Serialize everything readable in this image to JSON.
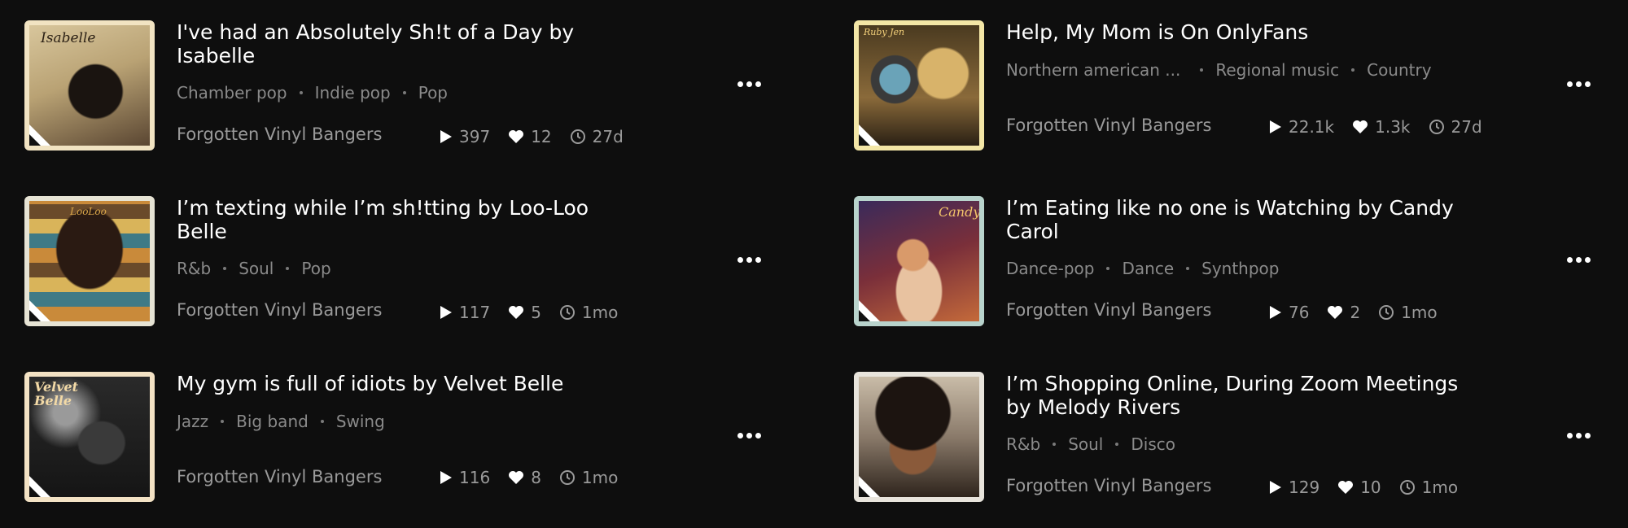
{
  "tracks": [
    {
      "title": "I've had an Absolutely Sh!t of a Day by Isabelle",
      "genres": [
        "Chamber pop",
        "Indie pop",
        "Pop"
      ],
      "playlist": "Forgotten Vinyl Bangers",
      "plays": "397",
      "likes": "12",
      "age": "27d",
      "cover_text": "Isabelle",
      "colors": {
        "bg1": "#c9b489",
        "bg2": "#3a2d22",
        "border": "#f1e3c2"
      }
    },
    {
      "title": "Help, My Mom is On OnlyFans",
      "genres": [
        "Northern american ...",
        "Regional music",
        "Country"
      ],
      "playlist": "Forgotten Vinyl Bangers",
      "plays": "22.1k",
      "likes": "1.3k",
      "age": "27d",
      "cover_text": "Ruby Jen",
      "colors": {
        "bg1": "#7a5a2a",
        "bg2": "#d6b072",
        "border": "#f3e6a6"
      }
    },
    {
      "title": "I’m texting while I’m sh!tting by Loo-Loo Belle",
      "genres": [
        "R&b",
        "Soul",
        "Pop"
      ],
      "playlist": "Forgotten Vinyl Bangers",
      "plays": "117",
      "likes": "5",
      "age": "1mo",
      "cover_text": "LooLoo",
      "colors": {
        "bg1": "#b97a3a",
        "bg2": "#3f6f7a",
        "border": "#e6e3d4"
      }
    },
    {
      "title": "I’m Eating like no one is Watching by Candy Carol",
      "genres": [
        "Dance-pop",
        "Dance",
        "Synthpop"
      ],
      "playlist": "Forgotten Vinyl Bangers",
      "plays": "76",
      "likes": "2",
      "age": "1mo",
      "cover_text": "Candy",
      "colors": {
        "bg1": "#6a2f3a",
        "bg2": "#c46a3a",
        "border": "#b8d3cc"
      }
    },
    {
      "title": "My gym is full of idiots by Velvet Belle",
      "genres": [
        "Jazz",
        "Big band",
        "Swing"
      ],
      "playlist": "Forgotten Vinyl Bangers",
      "plays": "116",
      "likes": "8",
      "age": "1mo",
      "cover_text": "Velvet Belle",
      "colors": {
        "bg1": "#1b1b1b",
        "bg2": "#5a5a5a",
        "border": "#f3e2c4"
      }
    },
    {
      "title": "I’m Shopping Online, During Zoom Meetings by Melody Rivers",
      "genres": [
        "R&b",
        "Soul",
        "Disco"
      ],
      "playlist": "Forgotten Vinyl Bangers",
      "plays": "129",
      "likes": "10",
      "age": "1mo",
      "cover_text": "",
      "colors": {
        "bg1": "#8a7a6a",
        "bg2": "#2e241c",
        "border": "#e8e4dc"
      }
    }
  ],
  "icons": {
    "play": "play-icon",
    "like": "heart-icon",
    "age": "clock-icon",
    "more": "more-horizontal-icon",
    "corner": "triangle-badge-icon"
  }
}
